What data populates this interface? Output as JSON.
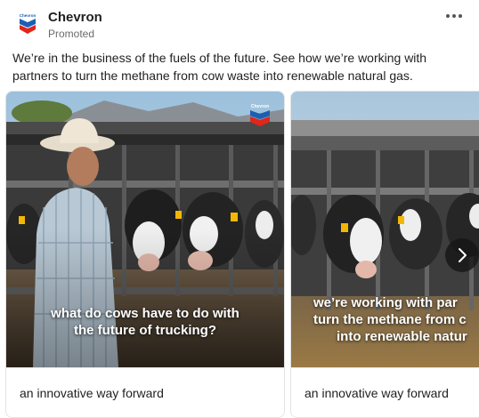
{
  "post": {
    "author": "Chevron",
    "sponsored_label": "Promoted",
    "text": "We’re in the business of the fuels of the future. See how we’re working with partners to turn the methane from cow waste into renewable natural gas."
  },
  "brand": {
    "logo_text": "Chevron",
    "colors": {
      "blue": "#1a5fb4",
      "red": "#e1251b"
    }
  },
  "carousel": {
    "cards": [
      {
        "caption_lines": [
          "what do cows have to do with",
          "the future of trucking?"
        ],
        "title": "an innovative way forward"
      },
      {
        "caption_lines": [
          "we’re working with par",
          "turn the methane from c",
          "into renewable natur"
        ],
        "title": "an innovative way forward"
      }
    ],
    "next_icon": "chevron-right-icon"
  }
}
